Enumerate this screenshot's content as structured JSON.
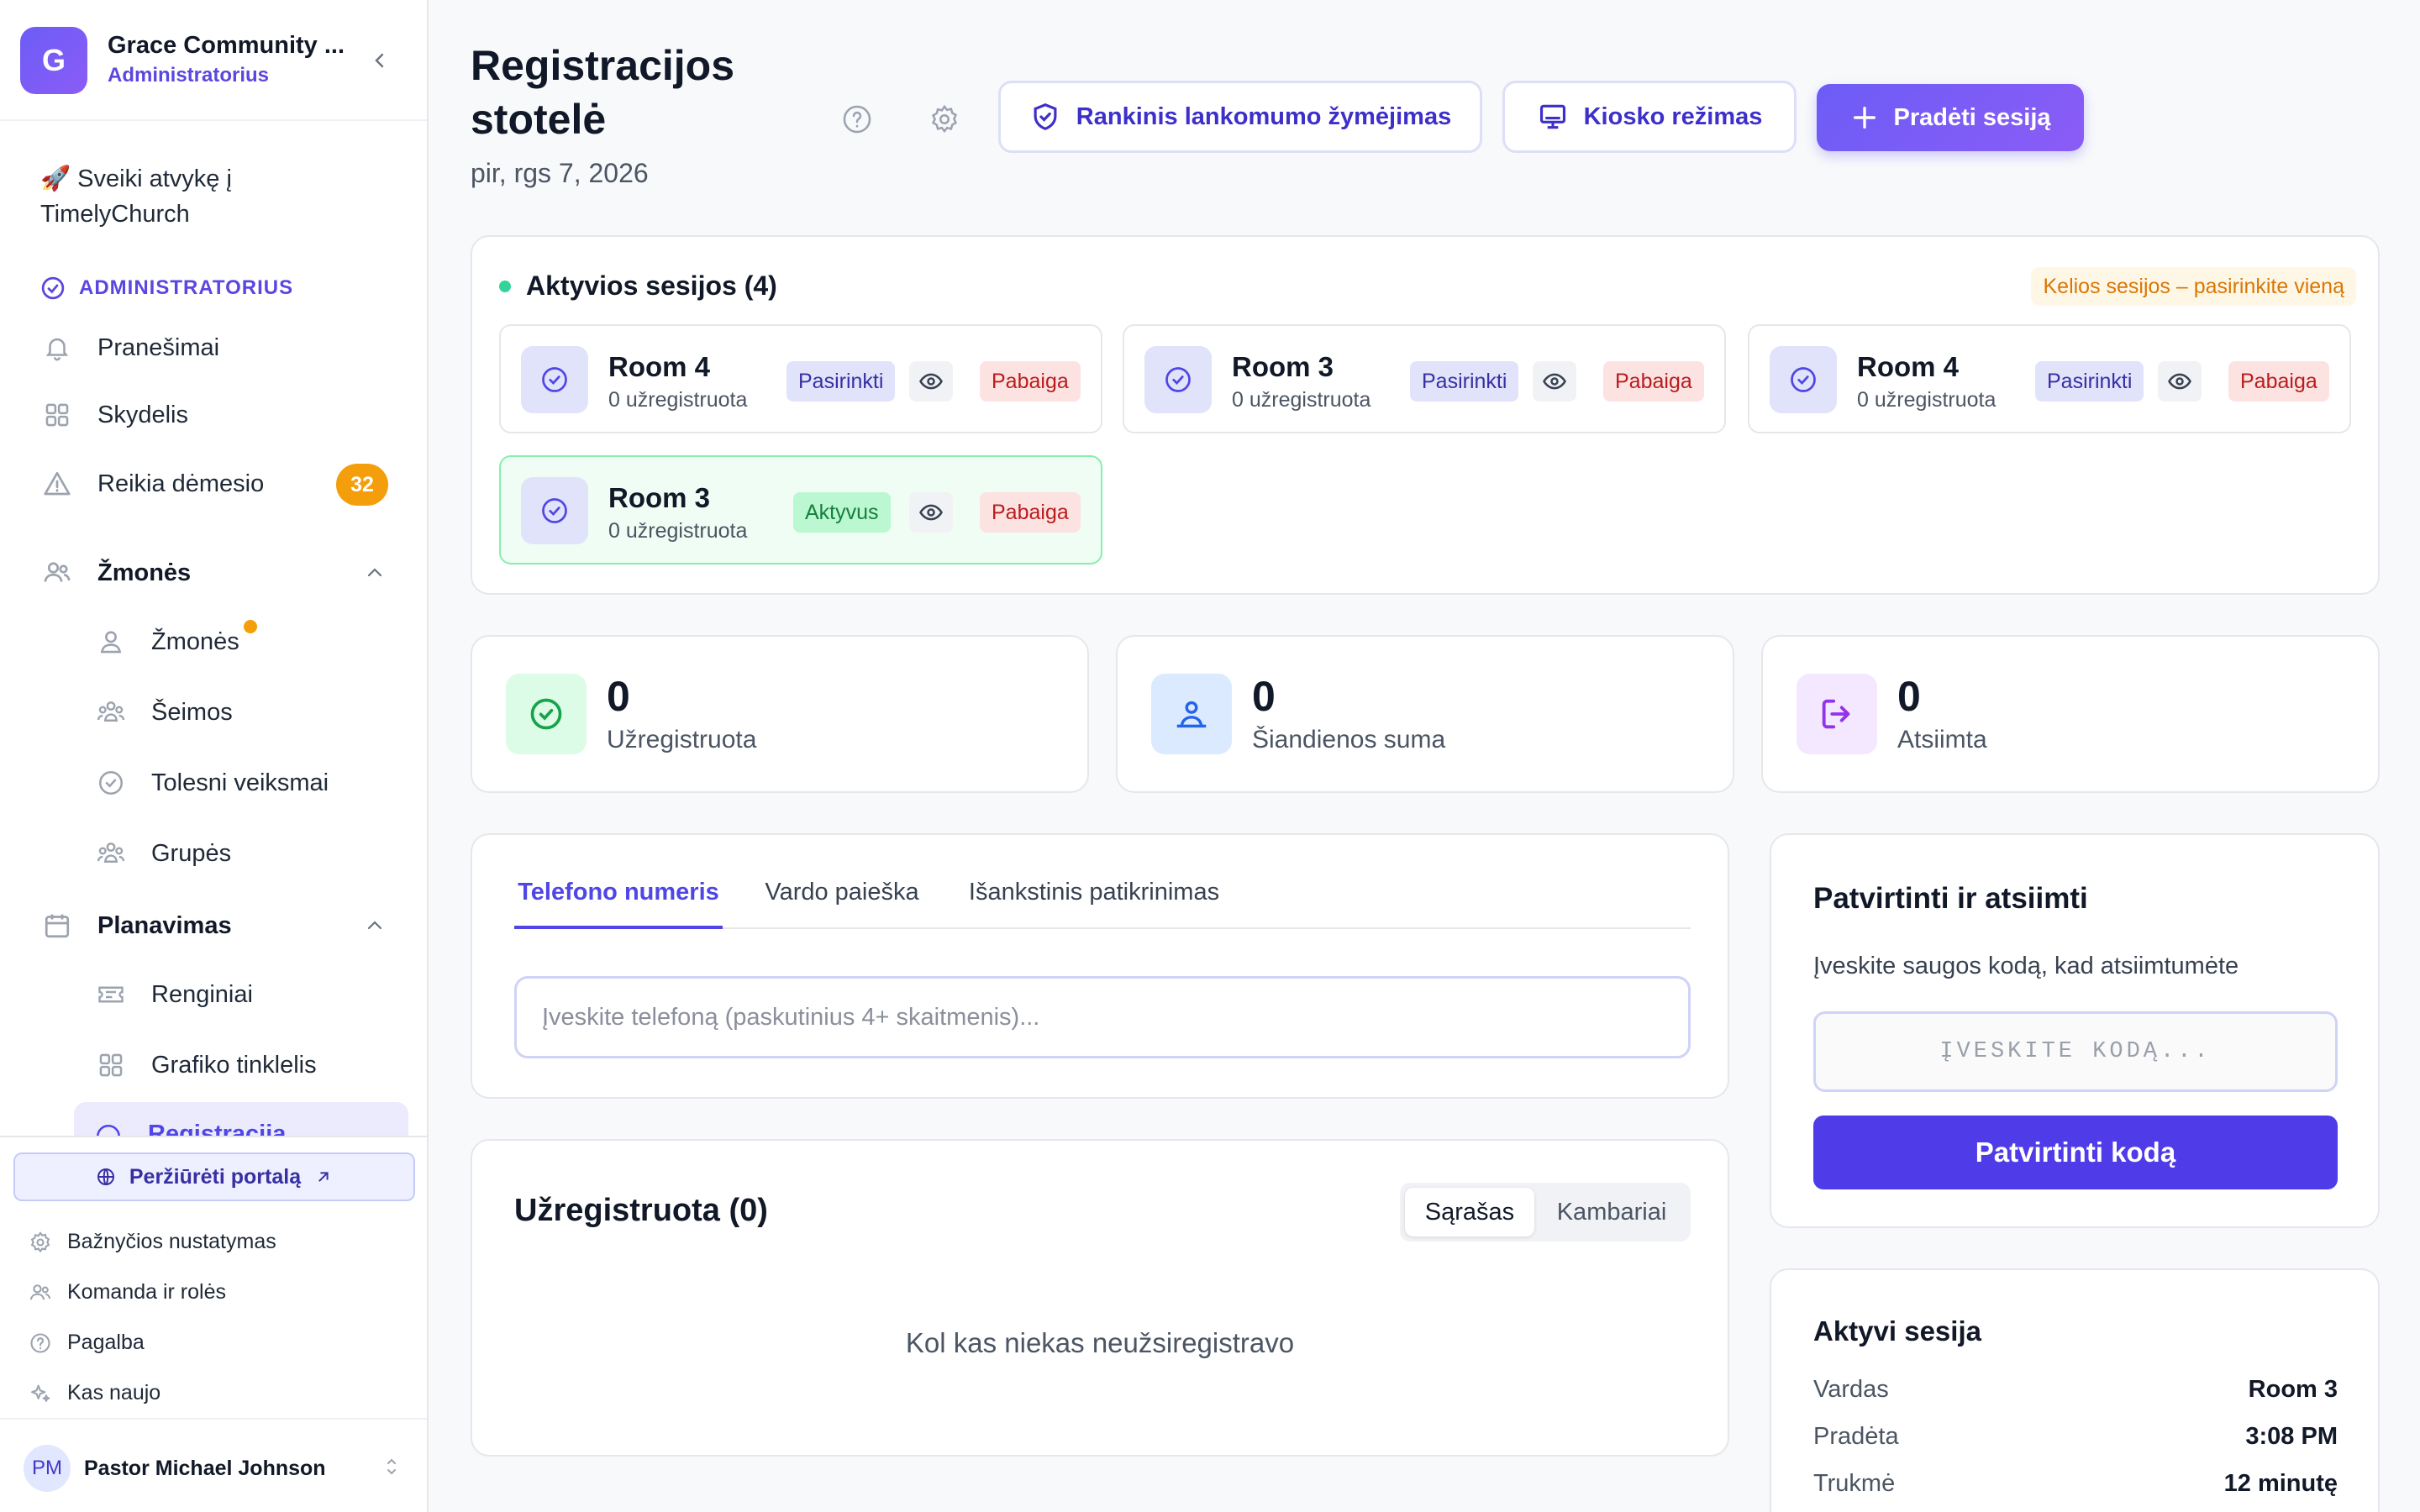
{
  "sidebar": {
    "org_initial": "G",
    "org_name": "Grace Community ...",
    "org_role": "Administratorius",
    "welcome": "🚀 Sveiki atvykę į TimelyChurch",
    "section_admin": "ADMINISTRATORIUS",
    "items": {
      "notifications": "Pranešimai",
      "dashboard": "Skydelis",
      "attention": "Reikia dėmesio",
      "attention_count": "32",
      "people_group": "Žmonės",
      "people": "Žmonės",
      "families": "Šeimos",
      "followups": "Tolesni veiksmai",
      "groups": "Grupės",
      "planning_group": "Planavimas",
      "events": "Renginiai",
      "schedule_grid": "Grafiko tinklelis",
      "registration": "Registracija"
    },
    "footer": {
      "portal": "Peržiūrėti portalą",
      "church_settings": "Bažnyčios nustatymas",
      "team_roles": "Komanda ir rolės",
      "help": "Pagalba",
      "whats_new": "Kas naujo"
    },
    "user": {
      "initials": "PM",
      "name": "Pastor Michael Johnson"
    }
  },
  "header": {
    "title": "Registracijos stotelė",
    "date": "pir, rgs 7, 2026",
    "manual_btn": "Rankinis lankomumo žymėjimas",
    "kiosk_btn": "Kiosko režimas",
    "start_btn": "Pradėti sesiją"
  },
  "sessions": {
    "title": "Aktyvios sesijos (4)",
    "note": "Kelios sesijos – pasirinkite vieną",
    "select_label": "Pasirinkti",
    "active_label": "Aktyvus",
    "end_label": "Pabaiga",
    "list": [
      {
        "name": "Room 4",
        "count": "0 užregistruota"
      },
      {
        "name": "Room 3",
        "count": "0 užregistruota"
      },
      {
        "name": "Room 4",
        "count": "0 užregistruota"
      },
      {
        "name": "Room 3",
        "count": "0 užregistruota"
      }
    ]
  },
  "stats": [
    {
      "value": "0",
      "label": "Užregistruota",
      "color": "#16a34a"
    },
    {
      "value": "0",
      "label": "Šiandienos suma",
      "color": "#2563eb"
    },
    {
      "value": "0",
      "label": "Atsiimta",
      "color": "#9333ea"
    }
  ],
  "search": {
    "tabs": [
      "Telefono numeris",
      "Vardo paieška",
      "Išankstinis patikrinimas"
    ],
    "placeholder": "Įveskite telefoną (paskutinius 4+ skaitmenis)..."
  },
  "registered": {
    "title": "Užregistruota (0)",
    "view_list": "Sąrašas",
    "view_rooms": "Kambariai",
    "empty": "Kol kas niekas neužsiregistravo"
  },
  "verify": {
    "title": "Patvirtinti ir atsiimti",
    "desc": "Įveskite saugos kodą, kad atsiimtumėte",
    "placeholder": "ĮVESKITE KODĄ...",
    "button": "Patvirtinti kodą"
  },
  "active_session": {
    "title": "Aktyvi sesija",
    "rows": [
      {
        "k": "Vardas",
        "v": "Room 3"
      },
      {
        "k": "Pradėta",
        "v": "3:08 PM"
      },
      {
        "k": "Trukmė",
        "v": "12 minutę"
      }
    ]
  },
  "colors": {
    "accent": "#4f46e5",
    "brand": "#6d5cf6",
    "warning": "#f59e0b"
  }
}
